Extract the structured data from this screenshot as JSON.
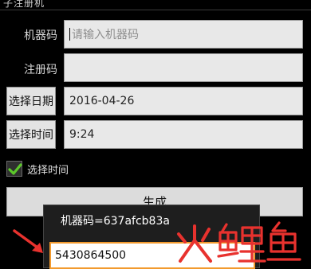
{
  "app": {
    "title": "子注册机"
  },
  "form": {
    "machine_label": "机器码",
    "machine_placeholder": "请输入机器码",
    "register_label": "注册码",
    "select_date_label": "选择日期",
    "date_value": "2016-04-26",
    "select_time_button": "选择时间",
    "time_value": "9:24",
    "checkbox_label": "选择时间",
    "checkbox_checked": true,
    "generate_label": "生成"
  },
  "dialog": {
    "machine_code_text": "机器码=637afcb83a",
    "register_code_value": "5430864500"
  },
  "colors": {
    "checkmark": "#5cc82a",
    "arrow": "#e8322e",
    "watermark": "#e8322e",
    "dialog_focus": "#f29a2e"
  },
  "icons": {
    "checkmark": "check-icon",
    "arrow": "red-arrow-icon",
    "watermark": "fish-logo"
  }
}
